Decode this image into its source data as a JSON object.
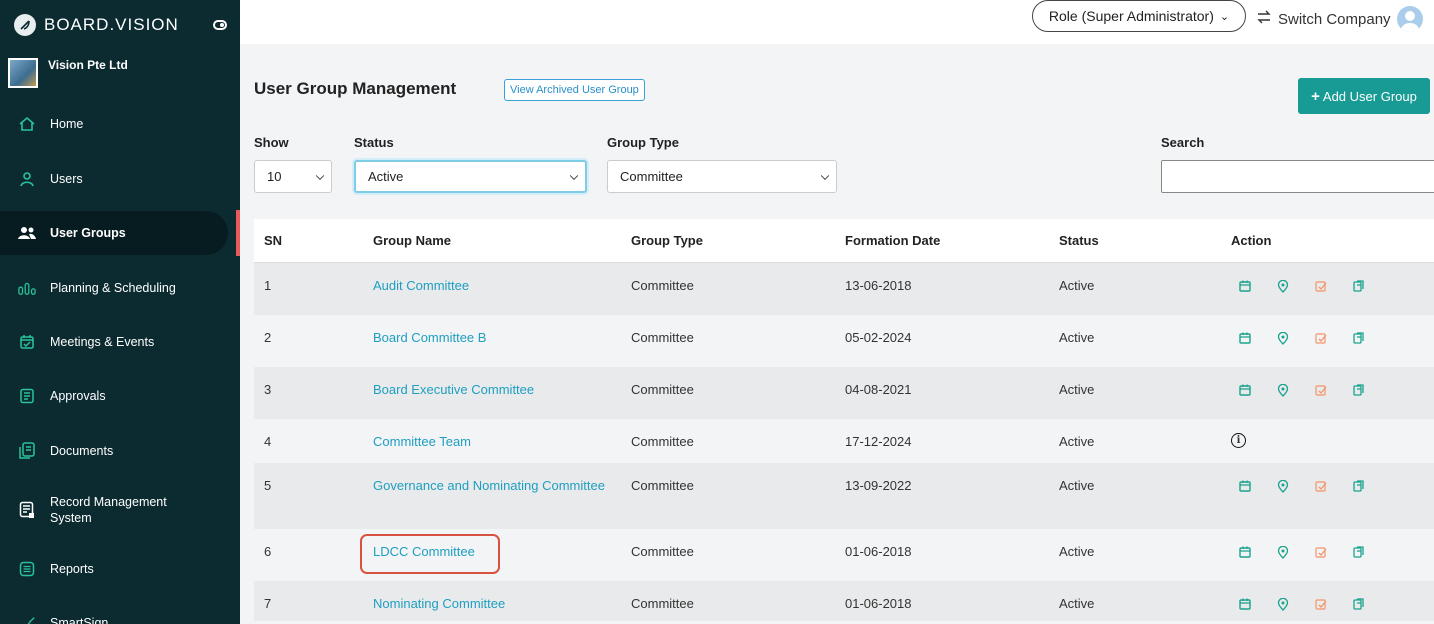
{
  "brand": {
    "name": "BOARD.VISION"
  },
  "company": {
    "name": "Vision Pte Ltd"
  },
  "sidebar": {
    "items": [
      {
        "label": "Home",
        "icon": "home-icon"
      },
      {
        "label": "Users",
        "icon": "user-icon"
      },
      {
        "label": "User Groups",
        "icon": "user-groups-icon",
        "active": true
      },
      {
        "label": "Planning & Scheduling",
        "icon": "planning-icon"
      },
      {
        "label": "Meetings & Events",
        "icon": "calendar-icon"
      },
      {
        "label": "Approvals",
        "icon": "approvals-icon"
      },
      {
        "label": "Documents",
        "icon": "documents-icon"
      },
      {
        "label": "Record Management System",
        "icon": "records-icon"
      },
      {
        "label": "Reports",
        "icon": "reports-icon"
      },
      {
        "label": "SmartSign",
        "icon": "smartsign-icon"
      }
    ]
  },
  "topbar": {
    "role": "Role (Super Administrator)",
    "switch_company": "Switch Company"
  },
  "main": {
    "title": "User Group Management",
    "archived_button": "View Archived User Group",
    "add_button": "Add User Group",
    "filters": {
      "show_label": "Show",
      "show_value": "10",
      "status_label": "Status",
      "status_value": "Active",
      "group_type_label": "Group Type",
      "group_type_value": "Committee",
      "search_label": "Search",
      "search_value": ""
    },
    "table": {
      "headers": [
        "SN",
        "Group Name",
        "Group Type",
        "Formation Date",
        "Status",
        "Action"
      ],
      "rows": [
        {
          "sn": "1",
          "name": "Audit Committee",
          "type": "Committee",
          "date": "13-06-2018",
          "status": "Active",
          "actions": "full"
        },
        {
          "sn": "2",
          "name": "Board Committee B",
          "type": "Committee",
          "date": "05-02-2024",
          "status": "Active",
          "actions": "full"
        },
        {
          "sn": "3",
          "name": "Board Executive Committee",
          "type": "Committee",
          "date": "04-08-2021",
          "status": "Active",
          "actions": "full"
        },
        {
          "sn": "4",
          "name": "Committee Team",
          "type": "Committee",
          "date": "17-12-2024",
          "status": "Active",
          "actions": "info"
        },
        {
          "sn": "5",
          "name": "Governance and Nominating Committee",
          "type": "Committee",
          "date": "13-09-2022",
          "status": "Active",
          "actions": "full"
        },
        {
          "sn": "6",
          "name": "LDCC Committee",
          "type": "Committee",
          "date": "01-06-2018",
          "status": "Active",
          "actions": "full"
        },
        {
          "sn": "7",
          "name": "Nominating Committee",
          "type": "Committee",
          "date": "01-06-2018",
          "status": "Active",
          "actions": "full"
        }
      ]
    }
  },
  "colors": {
    "sidebar_bg": "#0c2b30",
    "accent": "#179b94",
    "link": "#1e9fc0",
    "highlight": "#d8533f"
  }
}
